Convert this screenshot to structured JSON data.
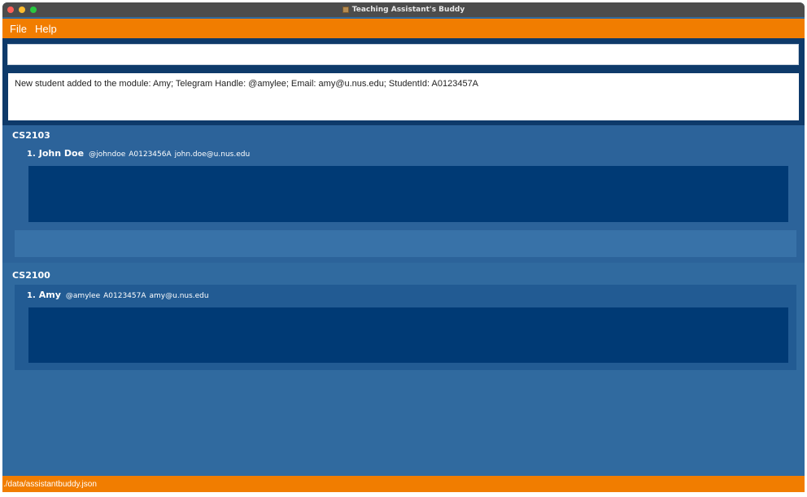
{
  "window": {
    "title": "Teaching Assistant's Buddy",
    "traffic_lights": [
      "#ff5f57",
      "#febc2e",
      "#28c840"
    ],
    "app_icon": "app-icon"
  },
  "menubar": {
    "items": [
      {
        "label": "File"
      },
      {
        "label": "Help"
      }
    ],
    "color": "#f17d00"
  },
  "command": {
    "value": "",
    "placeholder": ""
  },
  "result": {
    "message": "New student added to the module: Amy; Telegram Handle: @amylee; Email: amy@u.nus.edu; StudentId: A0123457A"
  },
  "modules": [
    {
      "code": "CS2103",
      "students": [
        {
          "index": "1.",
          "name": "John Doe",
          "telegram": "@johndoe",
          "student_id": "A0123456A",
          "email": "john.doe@u.nus.edu"
        }
      ]
    },
    {
      "code": "CS2100",
      "students": [
        {
          "index": "1.",
          "name": "Amy",
          "telegram": "@amylee",
          "student_id": "A0123457A",
          "email": "amy@u.nus.edu"
        }
      ]
    }
  ],
  "status": {
    "file_path": "./data/assistantbuddy.json"
  },
  "colors": {
    "background": "#306a9f",
    "module_panel": "#2c639a",
    "notes_box": "#003a75",
    "command_area": "#0e3a6a",
    "accent": "#f17d00"
  }
}
